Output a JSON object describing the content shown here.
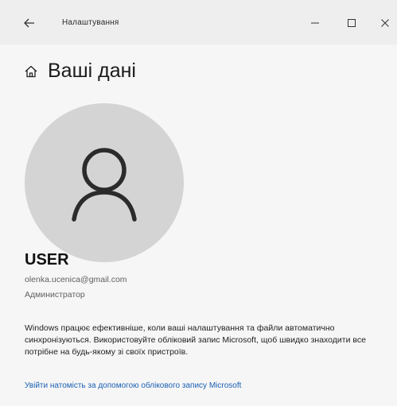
{
  "window": {
    "title": "Налаштування"
  },
  "header": {
    "title": "Ваші дані"
  },
  "account": {
    "name": "USER",
    "email": "olenka.ucenica@gmail.com",
    "role": "Администратор"
  },
  "info": {
    "text": "Windows працює ефективніше, коли ваші налаштування та файли автоматично синхронізуються. Використовуйте обліковий запис Microsoft, щоб швидко знаходити все потрібне на будь-якому зі своїх пристроїв."
  },
  "actions": {
    "sign_in_ms_link": "Увійти натомість за допомогою облікового запису Microsoft"
  },
  "icons": {
    "back": "back-arrow-icon",
    "minimize": "minimize-icon",
    "maximize": "maximize-icon",
    "close": "close-icon",
    "home": "home-icon",
    "user": "user-icon"
  },
  "colors": {
    "avatar_bg": "#d4d4d4",
    "link": "#1a5fb4"
  }
}
